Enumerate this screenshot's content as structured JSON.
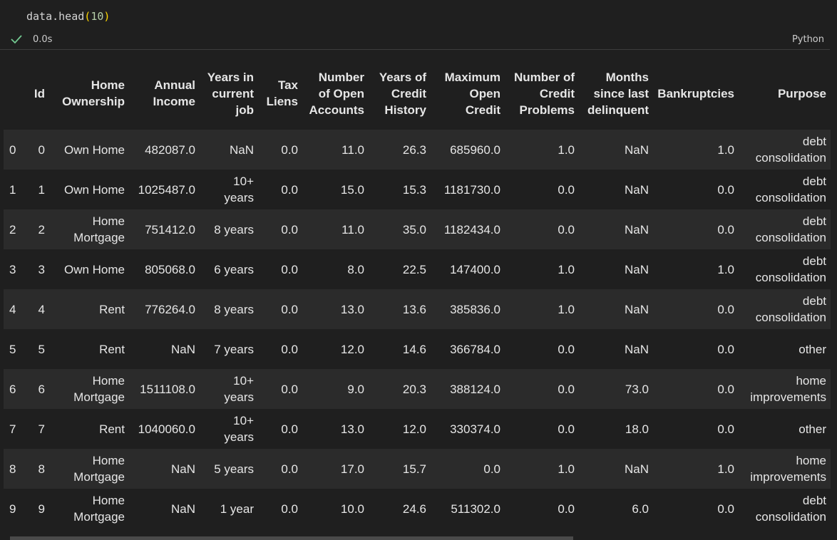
{
  "cell": {
    "code_prefix": "data.head",
    "code_open": "(",
    "code_arg": "10",
    "code_close": ")",
    "exec_time": "0.0s",
    "language": "Python"
  },
  "table": {
    "columns": [
      "",
      "Id",
      "Home Ownership",
      "Annual Income",
      "Years in current job",
      "Tax Liens",
      "Number of Open Accounts",
      "Years of Credit History",
      "Maximum Open Credit",
      "Number of Credit Problems",
      "Months since last delinquent",
      "Bankruptcies",
      "Purpose"
    ],
    "rows": [
      [
        "0",
        "0",
        "Own Home",
        "482087.0",
        "NaN",
        "0.0",
        "11.0",
        "26.3",
        "685960.0",
        "1.0",
        "NaN",
        "1.0",
        "debt consolidation"
      ],
      [
        "1",
        "1",
        "Own Home",
        "1025487.0",
        "10+ years",
        "0.0",
        "15.0",
        "15.3",
        "1181730.0",
        "0.0",
        "NaN",
        "0.0",
        "debt consolidation"
      ],
      [
        "2",
        "2",
        "Home Mortgage",
        "751412.0",
        "8 years",
        "0.0",
        "11.0",
        "35.0",
        "1182434.0",
        "0.0",
        "NaN",
        "0.0",
        "debt consolidation"
      ],
      [
        "3",
        "3",
        "Own Home",
        "805068.0",
        "6 years",
        "0.0",
        "8.0",
        "22.5",
        "147400.0",
        "1.0",
        "NaN",
        "1.0",
        "debt consolidation"
      ],
      [
        "4",
        "4",
        "Rent",
        "776264.0",
        "8 years",
        "0.0",
        "13.0",
        "13.6",
        "385836.0",
        "1.0",
        "NaN",
        "0.0",
        "debt consolidation"
      ],
      [
        "5",
        "5",
        "Rent",
        "NaN",
        "7 years",
        "0.0",
        "12.0",
        "14.6",
        "366784.0",
        "0.0",
        "NaN",
        "0.0",
        "other"
      ],
      [
        "6",
        "6",
        "Home Mortgage",
        "1511108.0",
        "10+ years",
        "0.0",
        "9.0",
        "20.3",
        "388124.0",
        "0.0",
        "73.0",
        "0.0",
        "home improvements"
      ],
      [
        "7",
        "7",
        "Rent",
        "1040060.0",
        "10+ years",
        "0.0",
        "13.0",
        "12.0",
        "330374.0",
        "0.0",
        "18.0",
        "0.0",
        "other"
      ],
      [
        "8",
        "8",
        "Home Mortgage",
        "NaN",
        "5 years",
        "0.0",
        "17.0",
        "15.7",
        "0.0",
        "1.0",
        "NaN",
        "1.0",
        "home improvements"
      ],
      [
        "9",
        "9",
        "Home Mortgage",
        "NaN",
        "1 year",
        "0.0",
        "10.0",
        "24.6",
        "511302.0",
        "0.0",
        "6.0",
        "0.0",
        "debt consolidation"
      ]
    ]
  },
  "icons": {
    "status": "check-icon"
  },
  "colors": {
    "success": "#73c991",
    "background": "#1f1f1f",
    "row_alt": "#2b2b2b"
  }
}
